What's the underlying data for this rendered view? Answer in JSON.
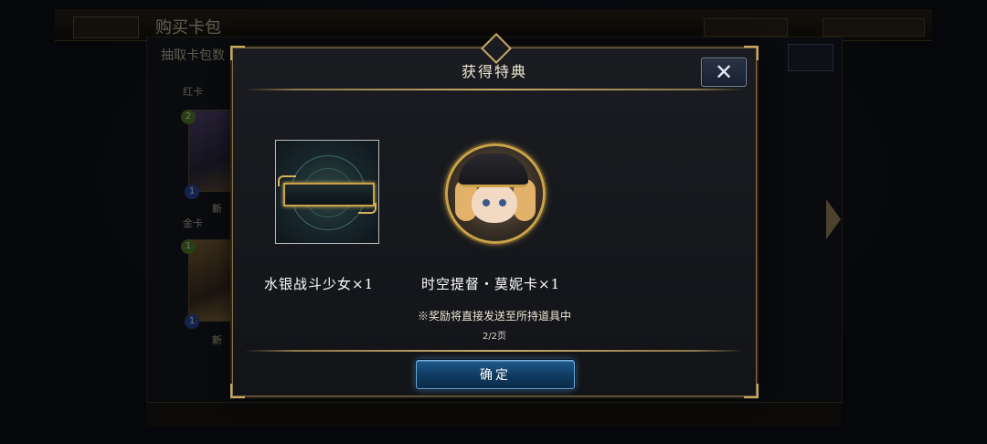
{
  "background": {
    "screen_title": "购买卡包",
    "subtitle": "抽取卡包数",
    "section_red": "红卡",
    "section_gold": "金卡",
    "new_label": "新",
    "gems": [
      "2",
      "1",
      "1",
      "1",
      "2"
    ]
  },
  "dialog": {
    "title": "获得特典",
    "close_icon": "close-icon",
    "rewards": [
      {
        "name": "水银战斗少女×1",
        "icon": "item-card-icon"
      },
      {
        "name": "时空提督・莫妮卡×1",
        "icon": "emblem-avatar-icon"
      }
    ],
    "notice": "※奖励将直接发送至所持道具中",
    "pager": "2/2页",
    "confirm_label": "确定"
  },
  "colors": {
    "accent_gold": "#c9a24a",
    "confirm_blue": "#1f5a8c"
  }
}
